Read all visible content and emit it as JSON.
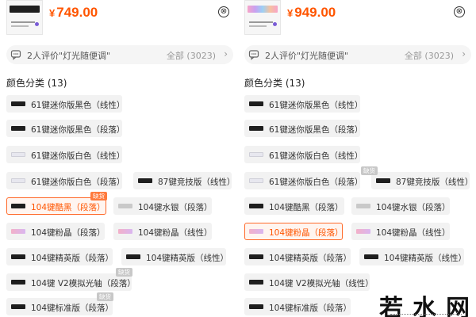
{
  "left": {
    "currency": "¥",
    "price": "749.00",
    "close_symbol": "⊗",
    "review_text": "2人评价\"灯光随便调\"",
    "review_all": "全部 (3023)",
    "review_chevron": "›",
    "section_title": "颜色分类 (13)",
    "options": [
      {
        "label": "61键迷你版黑色（线性）",
        "swatch": "black"
      },
      {
        "label": "61键迷你版黑色（段落）",
        "swatch": "black"
      },
      {
        "label": "61键迷你版白色（线性）",
        "swatch": "white"
      },
      {
        "label": "61键迷你版白色（段落）",
        "swatch": "white"
      },
      {
        "label": "87键竞技版（线性）",
        "swatch": "black"
      },
      {
        "label": "104键酷黑（段落）",
        "swatch": "black",
        "selected": true,
        "badge": "缺货"
      },
      {
        "label": "104键水银（段落）",
        "swatch": "silver"
      },
      {
        "label": "104键粉晶（段落）",
        "swatch": "pink"
      },
      {
        "label": "104键粉晶（线性）",
        "swatch": "pink"
      },
      {
        "label": "104键精英版（段落）",
        "swatch": "black"
      },
      {
        "label": "104键精英版（线性）",
        "swatch": "black"
      },
      {
        "label": "104键 V2模拟光轴（段落）",
        "swatch": "black",
        "badge": "缺货"
      },
      {
        "label": "104键标准版（段落）",
        "swatch": "black",
        "badge": "缺货"
      }
    ]
  },
  "right": {
    "currency": "¥",
    "price": "949.00",
    "close_symbol": "⊗",
    "review_text": "2人评价\"灯光随便调\"",
    "review_all": "全部 (3023)",
    "review_chevron": "›",
    "section_title": "颜色分类 (13)",
    "options": [
      {
        "label": "61键迷你版黑色（线性）",
        "swatch": "black"
      },
      {
        "label": "61键迷你版黑色（段落）",
        "swatch": "black"
      },
      {
        "label": "61键迷你版白色（线性）",
        "swatch": "white"
      },
      {
        "label": "61键迷你版白色（段落）",
        "swatch": "white"
      },
      {
        "label": "87键竞技版（线性）",
        "swatch": "black",
        "badge": "缺货"
      },
      {
        "label": "104键酷黑（段落）",
        "swatch": "black"
      },
      {
        "label": "104键水银（段落）",
        "swatch": "silver"
      },
      {
        "label": "104键粉晶（段落）",
        "swatch": "pink",
        "selected": true
      },
      {
        "label": "104键粉晶（线性）",
        "swatch": "pink"
      },
      {
        "label": "104键精英版（段落）",
        "swatch": "black"
      },
      {
        "label": "104键精英版（线性）",
        "swatch": "black"
      },
      {
        "label": "104键 V2模拟光轴（线性）",
        "swatch": "black"
      },
      {
        "label": "104键标准版（段落）",
        "swatch": "black"
      }
    ]
  },
  "watermark": "若水网",
  "colors": {
    "accent": "#ff5500",
    "selected_border": "#ff6a2a",
    "option_bg": "#f2f2f2",
    "badge": "#c8c8c8"
  }
}
